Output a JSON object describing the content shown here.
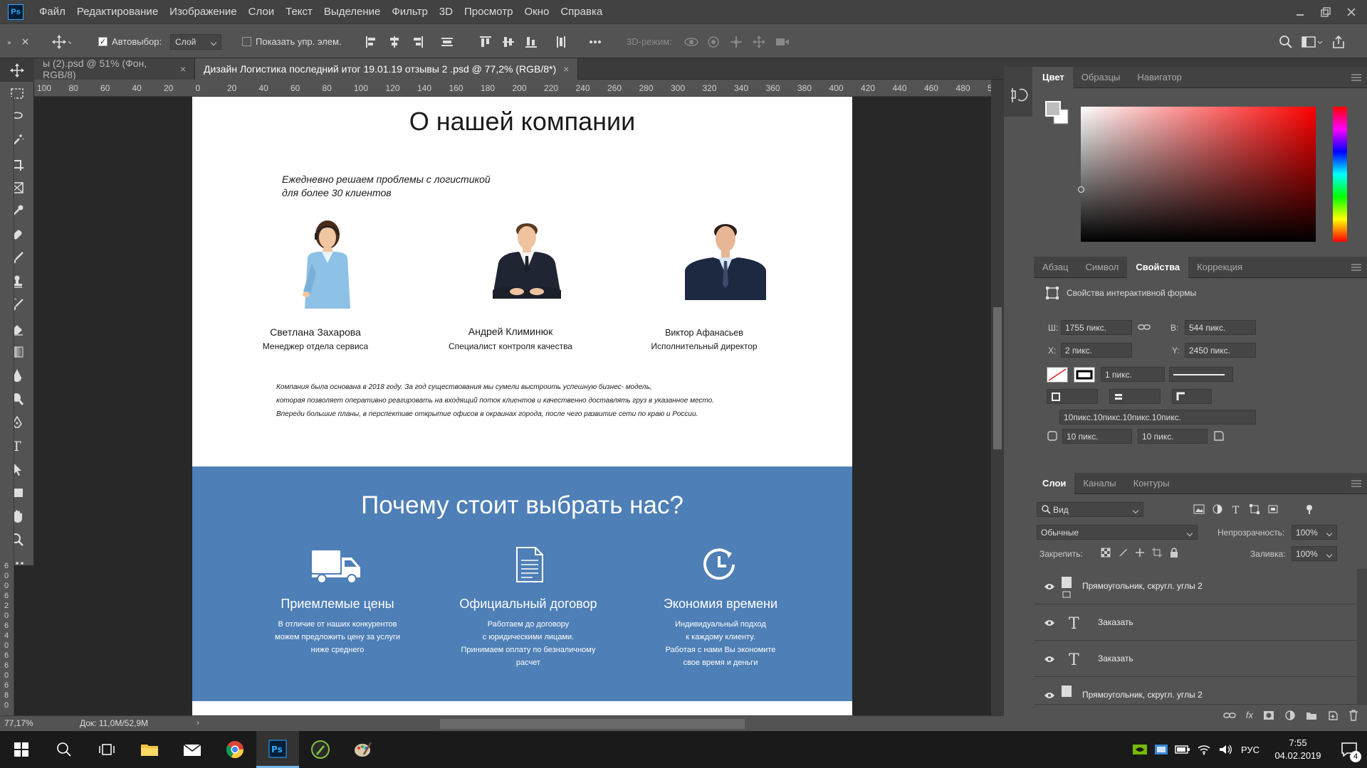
{
  "app": {
    "logo": "Ps"
  },
  "menu": [
    "Файл",
    "Редактирование",
    "Изображение",
    "Слои",
    "Текст",
    "Выделение",
    "Фильтр",
    "3D",
    "Просмотр",
    "Окно",
    "Справка"
  ],
  "options": {
    "autoselect_label": "Автовыбор:",
    "autoselect_value": "Слой",
    "show_controls_label": "Показать упр. элем.",
    "mode3d_label": "3D-режим:"
  },
  "tabs": [
    {
      "label": "ы (2).psd @ 51% (Фон, RGB/8)",
      "close": "×"
    },
    {
      "label": "Дизайн Логистика последний итог 19.01.19 отзывы 2  .psd @ 77,2% (RGB/8*)",
      "close": "×"
    }
  ],
  "ruler": {
    "h_ticks": [
      "100",
      "80",
      "60",
      "40",
      "20",
      "0",
      "20",
      "40",
      "60",
      "80",
      "100",
      "120",
      "140",
      "160",
      "180",
      "200",
      "220",
      "240",
      "260",
      "280",
      "300",
      "320",
      "340",
      "360",
      "380",
      "400",
      "420",
      "440",
      "460",
      "480",
      "500"
    ],
    "v_ticks": [
      "6",
      "0",
      "0",
      "6",
      "2",
      "0",
      "6",
      "4",
      "0",
      "6",
      "6",
      "0",
      "6",
      "8",
      "0"
    ]
  },
  "document": {
    "about_title": "О нашей компании",
    "tagline_1": "Ежедневно решаем проблемы с логистикой",
    "tagline_2": "для более 30 клиентов",
    "team": [
      {
        "name": "Светлана Захарова",
        "role": "Менеджер отдела сервиса"
      },
      {
        "name": "Андрей Климинюк",
        "role": "Специалист контроля качества"
      },
      {
        "name": "Виктор Афанасьев",
        "role": "Исполнительный директор"
      }
    ],
    "about_p1": "Компания была основана в 2018 году. За год существования мы сумели выстроить успешную бизнес- модель,",
    "about_p2": "которая позволяет оперативно реагировать на входящий поток клиентов и качественно доставлять груз в указанное место.",
    "about_p3": "Впереди большие планы, в перспективе открытие офисов в окраинах города, после чего развитие сети по краю и России.",
    "why_title": "Почему стоит выбрать нас?",
    "features": [
      {
        "icon": "truck-icon",
        "title": "Приемлемые цены",
        "lines": [
          "В отличие от наших конкурентов",
          "можем предложить цену за услуги",
          "ниже среднего"
        ]
      },
      {
        "icon": "document-icon",
        "title": "Официальный договор",
        "lines": [
          "Работаем до договору",
          "с юридическими лицами.",
          "Принимаем оплату по безналичному",
          "расчет"
        ]
      },
      {
        "icon": "clock-icon",
        "title": "Экономия времени",
        "lines": [
          "Индивидуальный подход",
          "к каждому клиенту.",
          "Работая с нами Вы экономите",
          "свое время и деньги"
        ]
      }
    ]
  },
  "status": {
    "zoom": "77,17%",
    "doc": "Док: 11,0M/52,9M"
  },
  "color_panel": {
    "tabs": [
      "Цвет",
      "Образцы",
      "Навигатор"
    ]
  },
  "props_panel": {
    "tabs": [
      "Абзац",
      "Символ",
      "Свойства",
      "Коррекция"
    ],
    "title": "Свойства интерактивной формы",
    "w_label": "Ш:",
    "w": "1755 пикс.",
    "h_label": "В:",
    "h": "544 пикс.",
    "x_label": "X:",
    "x": "2 пикс.",
    "y_label": "Y:",
    "y": "2450 пикс.",
    "stroke": "1 пикс.",
    "radii": "10пикс.10пикс.10пикс.10пикс.",
    "r1": "10 пикс.",
    "r2": "10 пикс."
  },
  "layers_panel": {
    "tabs": [
      "Слои",
      "Каналы",
      "Контуры"
    ],
    "filter": "Вид",
    "blend": "Обычные",
    "opacity_label": "Непрозрачность:",
    "opacity": "100%",
    "lock_label": "Закрепить:",
    "fill_label": "Заливка:",
    "fill": "100%",
    "layers": [
      {
        "name": "Прямоугольник, скругл. углы 2",
        "kind": "shape"
      },
      {
        "name": "Заказать",
        "kind": "text"
      },
      {
        "name": "Заказать",
        "kind": "text"
      },
      {
        "name": "Прямоугольник, скругл. углы 2",
        "kind": "shape"
      }
    ]
  },
  "taskbar": {
    "lang": "РУС",
    "time": "7:55",
    "date": "04.02.2019",
    "notifications": "4"
  }
}
